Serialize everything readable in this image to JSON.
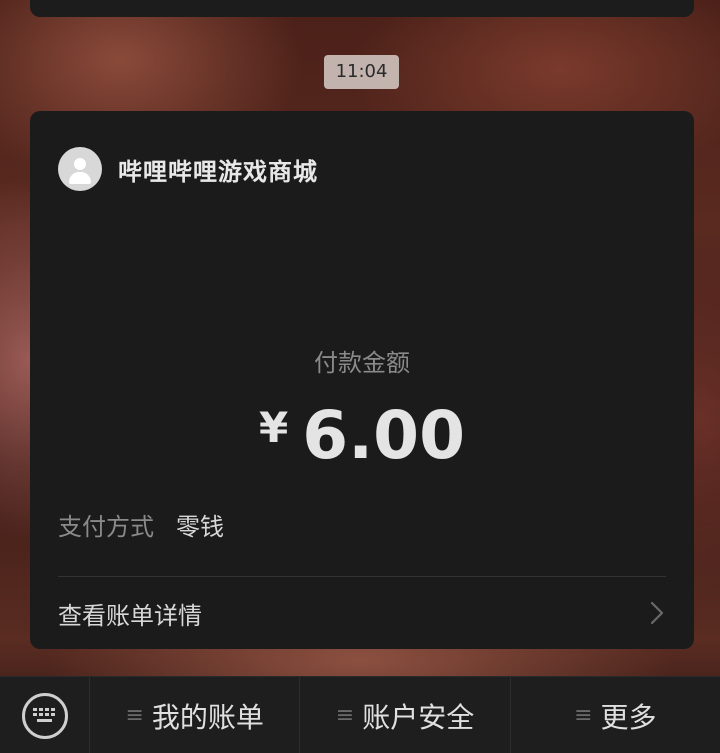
{
  "chat": {
    "timestamp": "11:04"
  },
  "payment_card": {
    "merchant_name": "哔哩哔哩游戏商城",
    "amount_label": "付款金额",
    "currency_symbol": "¥",
    "amount": "6.00",
    "pay_method_label": "支付方式",
    "pay_method_value": "零钱",
    "view_bill_label": "查看账单详情"
  },
  "bottom_menu": {
    "keyboard_icon": "keyboard-icon",
    "items": [
      {
        "label": "我的账单",
        "icon": "menu-icon"
      },
      {
        "label": "账户安全",
        "icon": "menu-icon"
      },
      {
        "label": "更多",
        "icon": "menu-icon"
      }
    ]
  },
  "colors": {
    "card_bg": "#1b1b1b",
    "bar_bg": "#1e1e1e",
    "amount_text": "#e4e4e4",
    "muted_text": "#8a8a8a"
  }
}
